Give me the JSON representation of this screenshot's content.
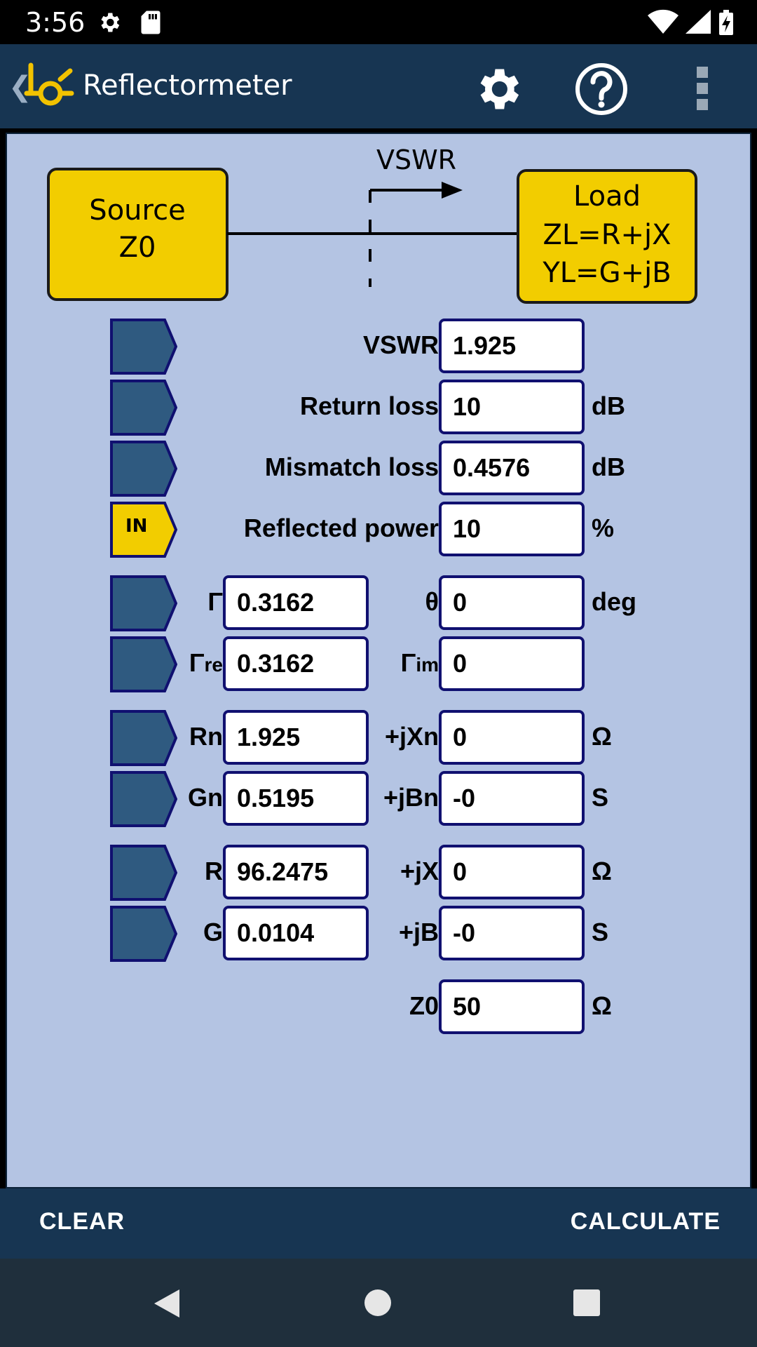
{
  "status": {
    "time": "3:56"
  },
  "app": {
    "title": "Reflectormeter",
    "back_glyph": "❮"
  },
  "diagram": {
    "source_line1": "Source",
    "source_line2": "Z0",
    "load_line1": "Load",
    "load_line2": "ZL=R+jX",
    "load_line3": "YL=G+jB",
    "vswr_label": "VSWR"
  },
  "rows": {
    "vswr": {
      "label": "VSWR",
      "value": "1.925",
      "unit": ""
    },
    "return_loss": {
      "label": "Return loss",
      "value": "10",
      "unit": "dB"
    },
    "mismatch_loss": {
      "label": "Mismatch loss",
      "value": "0.4576",
      "unit": "dB"
    },
    "reflected_power": {
      "label": "Reflected power",
      "value": "10",
      "unit": "%",
      "badge": "IN"
    },
    "gamma": {
      "label1": "Γ",
      "value1": "0.3162",
      "label2": "θ",
      "value2": "0",
      "unit": "deg"
    },
    "gamma_complex": {
      "label1_main": "Γ",
      "label1_sub": "re",
      "value1": "0.3162",
      "label2_main": "Γ",
      "label2_sub": "im",
      "value2": "0",
      "unit": ""
    },
    "rn": {
      "label1": "Rn",
      "value1": "1.925",
      "label2": "+jXn",
      "value2": "0",
      "unit": "Ω"
    },
    "gn": {
      "label1": "Gn",
      "value1": "0.5195",
      "label2": "+jBn",
      "value2": "-0",
      "unit": "S"
    },
    "r": {
      "label1": "R",
      "value1": "96.2475",
      "label2": "+jX",
      "value2": "0",
      "unit": "Ω"
    },
    "g": {
      "label1": "G",
      "value1": "0.0104",
      "label2": "+jB",
      "value2": "-0",
      "unit": "S"
    },
    "z0": {
      "label": "Z0",
      "value": "50",
      "unit": "Ω"
    }
  },
  "actions": {
    "clear": "CLEAR",
    "calculate": "CALCULATE"
  },
  "colors": {
    "app_bar": "#173552",
    "content_bg": "#b4c4e3",
    "row_button": "#2f5a80",
    "row_button_active": "#f2cd00",
    "field_border": "#101070",
    "diagram_box": "#f2cd00",
    "logo_accent": "#f2c200"
  },
  "icons": {
    "status_settings": "gear-icon",
    "status_sd": "sd-card-icon",
    "status_wifi": "wifi-icon",
    "status_signal": "signal-icon",
    "status_battery": "battery-icon",
    "logo": "reflectometer-logo",
    "settings": "gear-icon",
    "help": "help-circle-icon",
    "overflow": "more-vertical-icon"
  }
}
